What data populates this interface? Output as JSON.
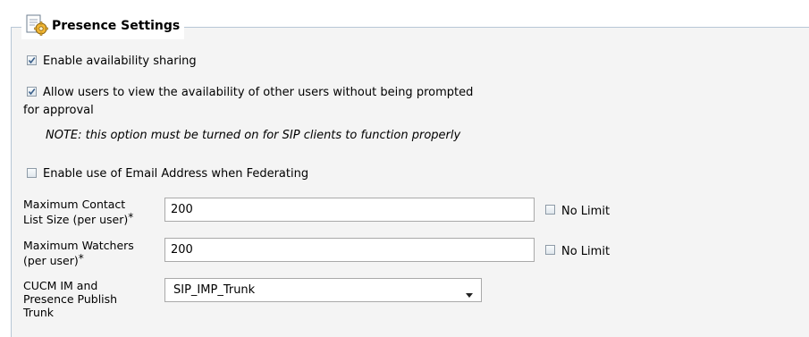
{
  "section": {
    "title": "Presence Settings",
    "icon": "settings-gear-icon"
  },
  "options": {
    "availability_sharing": {
      "label": "Enable availability sharing",
      "checked": true
    },
    "view_without_prompt": {
      "label_line1": "Allow users to view the availability of other users without being prompted",
      "label_line2": "for approval",
      "checked": true
    },
    "note": "NOTE: this option must be turned on for SIP clients to function properly",
    "email_federation": {
      "label": "Enable use of Email Address when Federating",
      "checked": false
    }
  },
  "fields": {
    "max_contact_list": {
      "label_line1": "Maximum Contact",
      "label_line2": "List Size (per user)",
      "required": "*",
      "value": "200",
      "no_limit_label": "No Limit",
      "no_limit_checked": false
    },
    "max_watchers": {
      "label_line1": "Maximum Watchers",
      "label_line2": "(per user)",
      "required": "*",
      "value": "200",
      "no_limit_label": "No Limit",
      "no_limit_checked": false
    },
    "publish_trunk": {
      "label_line1": "CUCM IM and",
      "label_line2": "Presence Publish",
      "label_line3": "Trunk",
      "selected": "SIP_IMP_Trunk"
    }
  },
  "colors": {
    "fieldset_border": "#b8c7d6",
    "panel_bg": "#f4f4f4",
    "checkmark": "#3a5f8a"
  }
}
